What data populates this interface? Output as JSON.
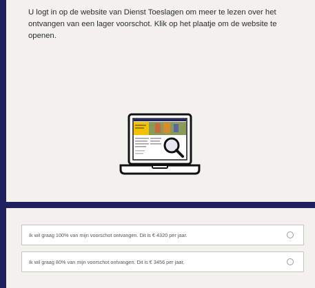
{
  "info": {
    "text": "U logt in op de website van Dienst Toeslagen om meer te lezen over het ontvangen van een lager voorschot. Klik op het plaatje om de website te openen."
  },
  "laptop": {
    "icon": "laptop-website-search-icon"
  },
  "options": [
    {
      "label": "Ik wil graag 100% van mijn voorschot ontvangen. Dit is € 4320 per jaar.",
      "selected": false
    },
    {
      "label": "Ik wil graag 80% van mijn voorschot ontvangen. Dit is € 3456 per jaar.",
      "selected": false
    }
  ],
  "colors": {
    "frame": "#1f2060",
    "panel": "#f3f1ee",
    "accent_yellow": "#f2c200"
  }
}
